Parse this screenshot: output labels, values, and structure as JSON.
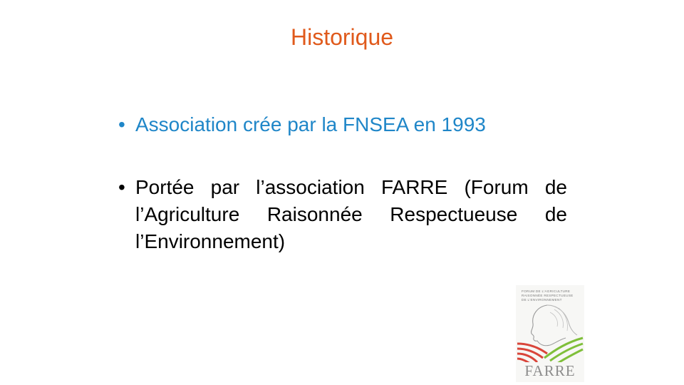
{
  "slide": {
    "title": "Historique",
    "bullets": [
      {
        "marker": "•",
        "text": "Association crée par la FNSEA en 1993"
      },
      {
        "marker": "•",
        "text": "Portée par l’association FARRE (Forum de l’Agriculture Raisonnée Respectueuse de l’Environnement)"
      }
    ]
  },
  "logo": {
    "caption": "Forum de l’Agriculture\nRaisonnée Respectueuse\nde l’Environnement",
    "name": "FARRE",
    "colors": {
      "red_stripes": "#d9453a",
      "green_stripes": "#7fbf3a",
      "outline": "#9a9a9a"
    }
  },
  "theme": {
    "title_color": "#e05a1c",
    "highlight_color": "#1f86c8",
    "text_color": "#000000",
    "background": "#ffffff"
  }
}
